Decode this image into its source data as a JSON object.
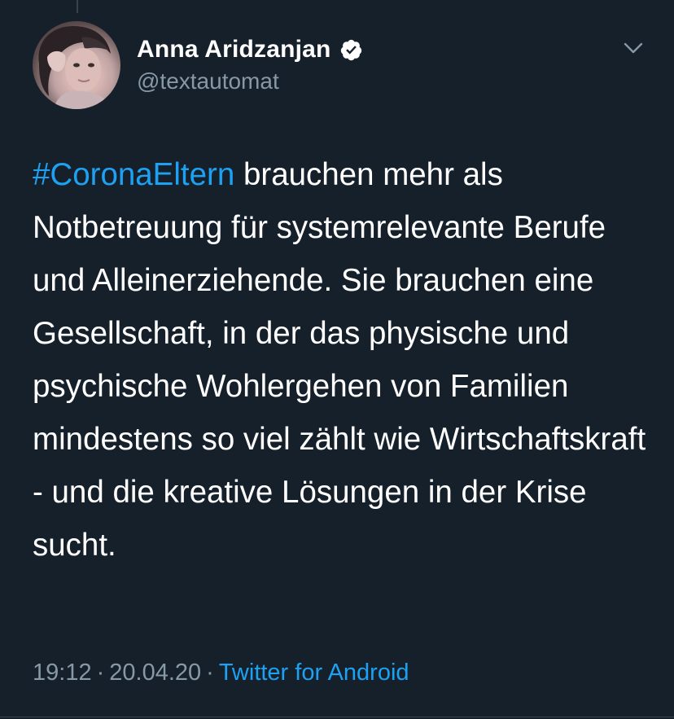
{
  "author": {
    "display_name": "Anna Aridzanjan",
    "handle": "@textautomat",
    "verified": true
  },
  "tweet": {
    "hashtag": "#CoronaEltern",
    "text": " brauchen mehr als Notbetreuung für systemrelevante Berufe und Alleinerziehende. Sie brauchen eine Gesellschaft, in der das physische und psychische Wohlergehen von Familien mindestens so viel zählt wie Wirtschaftskraft - und die kreative Lösungen in der Krise sucht."
  },
  "meta": {
    "time": "19:12",
    "separator": "·",
    "date": "20.04.20",
    "source": "Twitter for Android"
  },
  "icons": {
    "verified": "verified-badge-icon",
    "menu": "chevron-down-icon"
  },
  "colors": {
    "background": "#15202b",
    "link": "#1da1f2",
    "secondary_text": "#8899a6",
    "primary_text": "#ffffff"
  }
}
